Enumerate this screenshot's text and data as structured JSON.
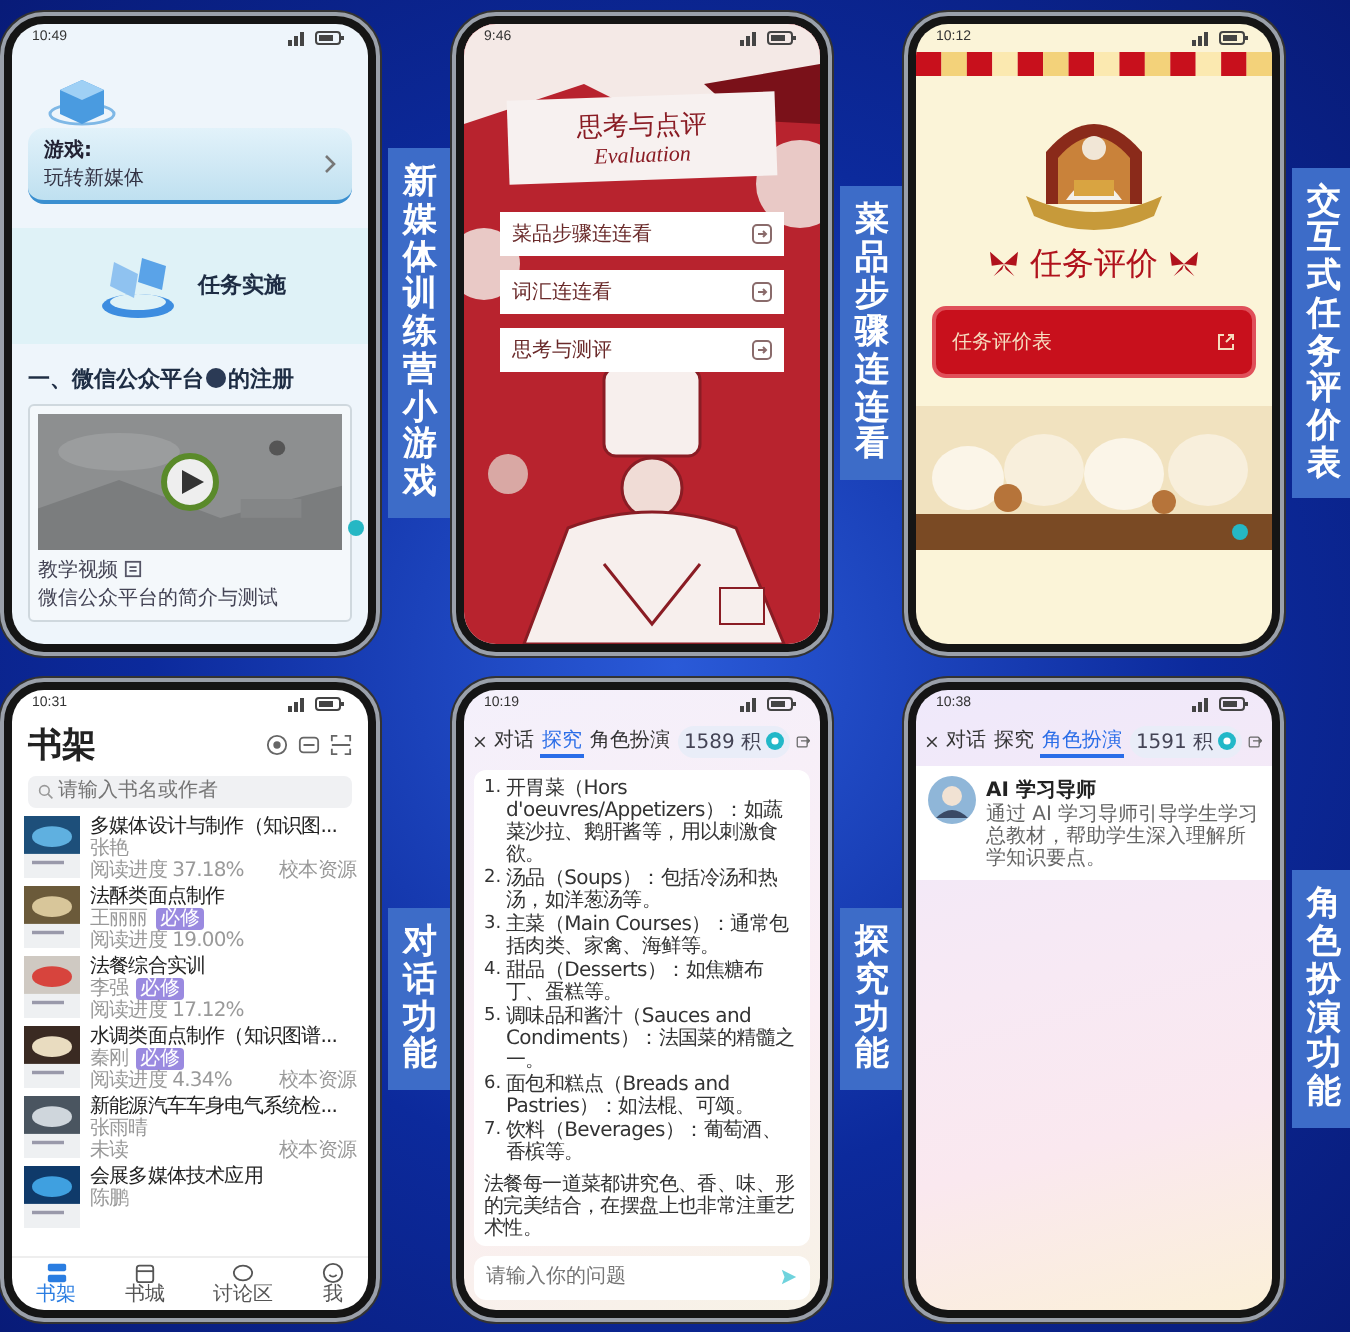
{
  "panels": [
    {
      "kind": "game",
      "caption": "新媒体训练营小游戏",
      "status_time": "10:49",
      "game_card": {
        "label": "游戏:",
        "title": "玩转新媒体"
      },
      "task_banner": "任务实施",
      "section_title": "一、微信公众平台",
      "section_title_tail": "的注册",
      "video_caption": "教学视频",
      "video_desc": "微信公众平台的简介与测试"
    },
    {
      "kind": "match",
      "caption": "菜品步骤连连看",
      "status_time": "9:46",
      "title": "思考与点评",
      "subtitle": "Evaluation",
      "buttons": [
        "菜品步骤连连看",
        "词汇连连看",
        "思考与测评"
      ]
    },
    {
      "kind": "evaluation",
      "caption": "交互式任务评价表",
      "status_time": "10:12",
      "title": "任务评价",
      "button": "任务评价表"
    },
    {
      "kind": "bookshelf",
      "caption": "对话功能",
      "status_time": "10:31",
      "title": "书架",
      "search_placeholder": "请输入书名或作者",
      "books": [
        {
          "title": "多媒体设计与制作（知识图...",
          "author": "张艳",
          "progress": "阅读进度 37.18%",
          "badge": "校本资源"
        },
        {
          "title": "法酥类面点制作",
          "author": "王丽丽",
          "tag": "必修",
          "progress": "阅读进度 19.00%"
        },
        {
          "title": "法餐综合实训",
          "author": "李强",
          "tag": "必修",
          "progress": "阅读进度 17.12%"
        },
        {
          "title": "水调类面点制作（知识图谱...",
          "author": "秦刚",
          "tag": "必修",
          "progress": "阅读进度 4.34%",
          "badge": "校本资源"
        },
        {
          "title": "新能源汽车车身电气系统检...",
          "author": "张雨晴",
          "progress": "未读",
          "badge": "校本资源"
        },
        {
          "title": "会展多媒体技术应用",
          "author": "陈鹏"
        }
      ],
      "nav": [
        {
          "label": "书架",
          "selected": true
        },
        {
          "label": "书城",
          "selected": false
        },
        {
          "label": "讨论区",
          "selected": false
        },
        {
          "label": "我",
          "selected": false
        }
      ]
    },
    {
      "kind": "chat",
      "caption": "探究功能",
      "status_time": "10:19",
      "tabs": [
        {
          "label": "对话",
          "selected": false
        },
        {
          "label": "探究",
          "selected": true
        },
        {
          "label": "角色扮演",
          "selected": false
        }
      ],
      "points": "1589 积",
      "items": [
        {
          "number": "1.",
          "text": "开胃菜（Hors d'oeuvres/Appetizers）：如蔬菜沙拉、鹅肝酱等，用以刺激食欲。"
        },
        {
          "number": "2.",
          "text": "汤品（Soups）：包括冷汤和热汤，如洋葱汤等。"
        },
        {
          "number": "3.",
          "text": "主菜（Main Courses）：通常包括肉类、家禽、海鲜等。"
        },
        {
          "number": "4.",
          "text": "甜品（Desserts）：如焦糖布丁、蛋糕等。"
        },
        {
          "number": "5.",
          "text": "调味品和酱汁（Sauces and Condiments）：法国菜的精髓之一。"
        },
        {
          "number": "6.",
          "text": "面包和糕点（Breads and Pastries）：如法棍、可颂。"
        },
        {
          "number": "7.",
          "text": "饮料（Beverages）：葡萄酒、香槟等。"
        }
      ],
      "summary": "法餐每一道菜都讲究色、香、味、形的完美结合，在摆盘上也非常注重艺术性。",
      "input_placeholder": "请输入你的问题"
    },
    {
      "kind": "roleplay",
      "caption": "角色扮演功能",
      "status_time": "10:38",
      "tabs": [
        {
          "label": "对话",
          "selected": false
        },
        {
          "label": "探究",
          "selected": false
        },
        {
          "label": "角色扮演",
          "selected": true
        }
      ],
      "points": "1591 积",
      "agent": {
        "name": "AI 学习导师",
        "description": "通过 AI 学习导师引导学生学习总教材，帮助学生深入理解所学知识要点。"
      }
    }
  ]
}
